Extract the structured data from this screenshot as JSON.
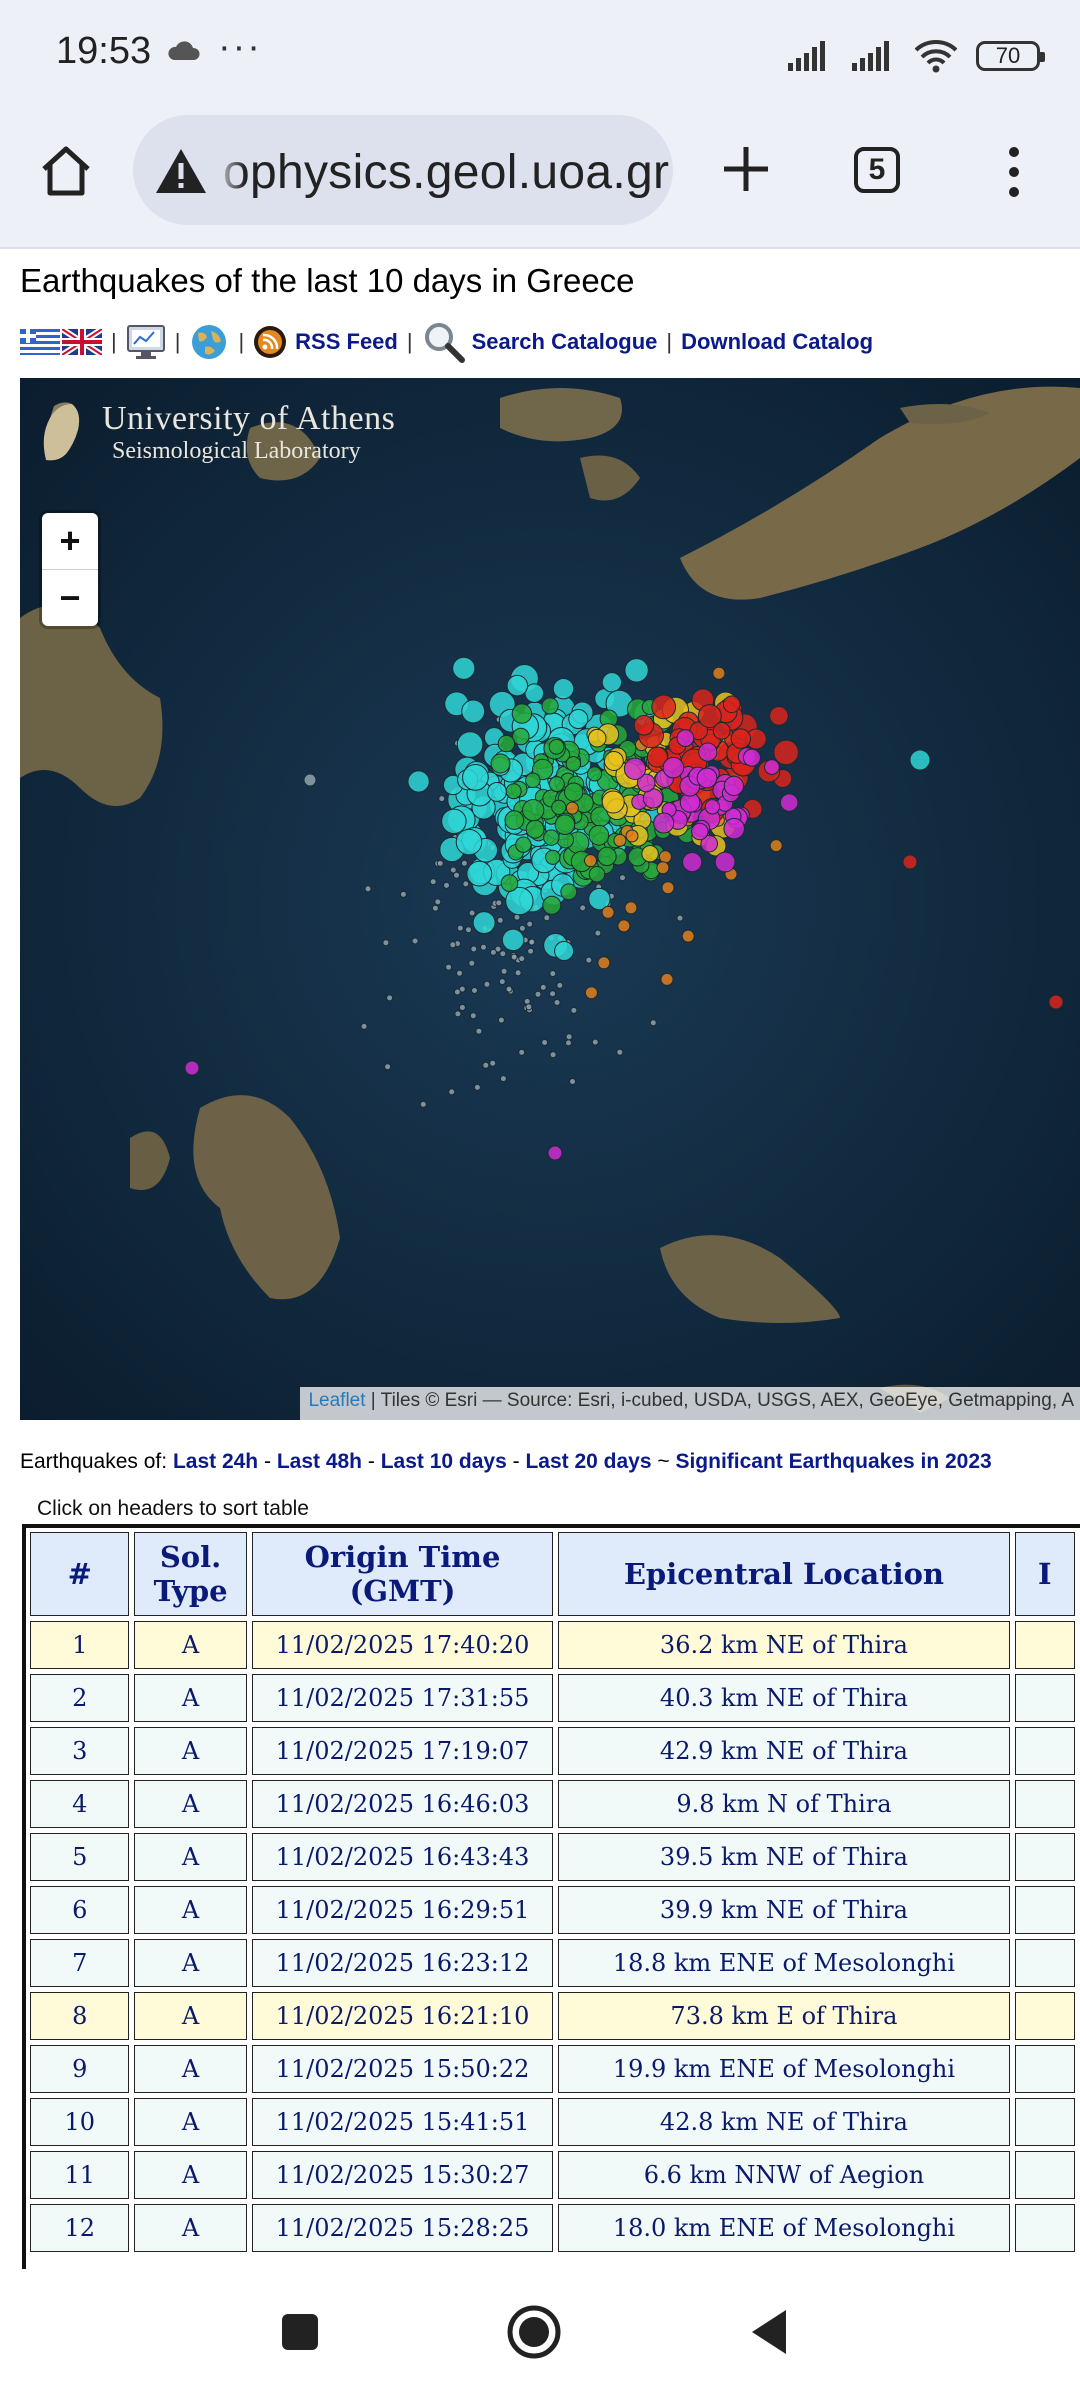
{
  "status_bar": {
    "time": "19:53",
    "more": "···",
    "battery": "70"
  },
  "browser": {
    "url": "ophysics.geol.uoa.gr",
    "tab_count": "5"
  },
  "page": {
    "title": "Earthquakes of the last 10 days in Greece",
    "links": {
      "rss": "RSS Feed",
      "search": "Search Catalogue",
      "download": "Download Catalog",
      "sep": "|"
    }
  },
  "map": {
    "logo_line1": "University of Athens",
    "logo_line2": "Seismological Laboratory",
    "zoom_in": "+",
    "zoom_out": "−",
    "attribution_link": "Leaflet",
    "attribution_text": " | Tiles © Esri — Source: Esri, i-cubed, USDA, USGS, AEX, GeoEye, Getmapping, A",
    "marker_colors": {
      "cyan": "#2fd6d6",
      "green": "#27a83a",
      "yellow": "#e8c21e",
      "orange": "#e07f1b",
      "red": "#d9241c",
      "magenta": "#cf2bd2",
      "grey": "#8fa2ae"
    }
  },
  "periods": {
    "prefix": "Earthquakes of:",
    "last24": "Last 24h",
    "last48": "Last 48h",
    "last10": "Last 10 days",
    "last20": "Last 20 days",
    "significant": "Significant Earthquakes in 2023",
    "dash": " - ",
    "tilde": " ~ "
  },
  "table": {
    "note": "Click on headers to sort table",
    "headers": {
      "num": "#",
      "sol_type": "Sol. Type",
      "origin_time": "Origin Time (GMT)",
      "location": "Epicentral Location",
      "next": "I"
    },
    "rows": [
      {
        "num": "1",
        "type": "A",
        "time": "11/02/2025 17:40:20",
        "location": "36.2 km NE of Thira"
      },
      {
        "num": "2",
        "type": "A",
        "time": "11/02/2025 17:31:55",
        "location": "40.3 km NE of Thira"
      },
      {
        "num": "3",
        "type": "A",
        "time": "11/02/2025 17:19:07",
        "location": "42.9 km NE of Thira"
      },
      {
        "num": "4",
        "type": "A",
        "time": "11/02/2025 16:46:03",
        "location": "9.8 km N of Thira"
      },
      {
        "num": "5",
        "type": "A",
        "time": "11/02/2025 16:43:43",
        "location": "39.5 km NE of Thira"
      },
      {
        "num": "6",
        "type": "A",
        "time": "11/02/2025 16:29:51",
        "location": "39.9 km NE of Thira"
      },
      {
        "num": "7",
        "type": "A",
        "time": "11/02/2025 16:23:12",
        "location": "18.8 km ENE of Mesolonghi"
      },
      {
        "num": "8",
        "type": "A",
        "time": "11/02/2025 16:21:10",
        "location": "73.8 km E of Thira"
      },
      {
        "num": "9",
        "type": "A",
        "time": "11/02/2025 15:50:22",
        "location": "19.9 km ENE of Mesolonghi"
      },
      {
        "num": "10",
        "type": "A",
        "time": "11/02/2025 15:41:51",
        "location": "42.8 km NE of Thira"
      },
      {
        "num": "11",
        "type": "A",
        "time": "11/02/2025 15:30:27",
        "location": "6.6 km NNW of Aegion"
      },
      {
        "num": "12",
        "type": "A",
        "time": "11/02/2025 15:28:25",
        "location": "18.0 km ENE of Mesolonghi"
      }
    ]
  }
}
